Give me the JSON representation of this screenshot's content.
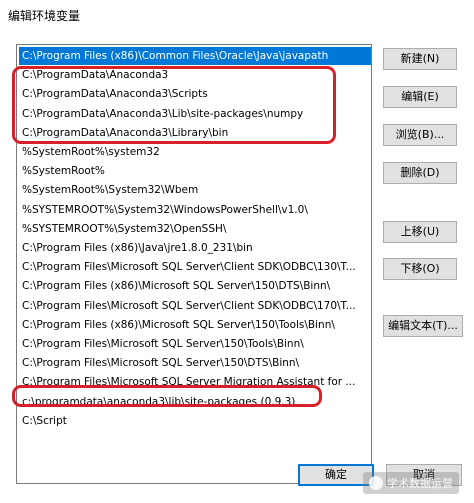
{
  "dialog": {
    "title": "编辑环境变量"
  },
  "paths": [
    "C:\\Program Files (x86)\\Common Files\\Oracle\\Java\\javapath",
    "C:\\ProgramData\\Anaconda3",
    "C:\\ProgramData\\Anaconda3\\Scripts",
    "C:\\ProgramData\\Anaconda3\\Lib\\site-packages\\numpy",
    "C:\\ProgramData\\Anaconda3\\Library\\bin",
    "%SystemRoot%\\system32",
    "%SystemRoot%",
    "%SystemRoot%\\System32\\Wbem",
    "%SYSTEMROOT%\\System32\\WindowsPowerShell\\v1.0\\",
    "%SYSTEMROOT%\\System32\\OpenSSH\\",
    "C:\\Program Files (x86)\\Java\\jre1.8.0_231\\bin",
    "C:\\Program Files\\Microsoft SQL Server\\Client SDK\\ODBC\\130\\T...",
    "C:\\Program Files (x86)\\Microsoft SQL Server\\150\\DTS\\Binn\\",
    "C:\\Program Files\\Microsoft SQL Server\\Client SDK\\ODBC\\170\\T...",
    "C:\\Program Files (x86)\\Microsoft SQL Server\\150\\Tools\\Binn\\",
    "C:\\Program Files\\Microsoft SQL Server\\150\\Tools\\Binn\\",
    "C:\\Program Files\\Microsoft SQL Server\\150\\DTS\\Binn\\",
    "C:\\Program Files\\Microsoft SQL Server Migration Assistant for ...",
    "c:\\programdata\\anaconda3\\lib\\site-packages (0.9.3)",
    "C:\\Script"
  ],
  "selected_index": 0,
  "buttons": {
    "new": "新建(N)",
    "edit": "编辑(E)",
    "browse": "浏览(B)...",
    "delete": "删除(D)",
    "move_up": "上移(U)",
    "move_down": "下移(O)",
    "edit_text": "编辑文本(T)...",
    "ok": "确定",
    "cancel": "取消"
  },
  "watermark": "学术数据运营",
  "colors": {
    "selection": "#0078d7",
    "highlight": "#d9202a"
  }
}
